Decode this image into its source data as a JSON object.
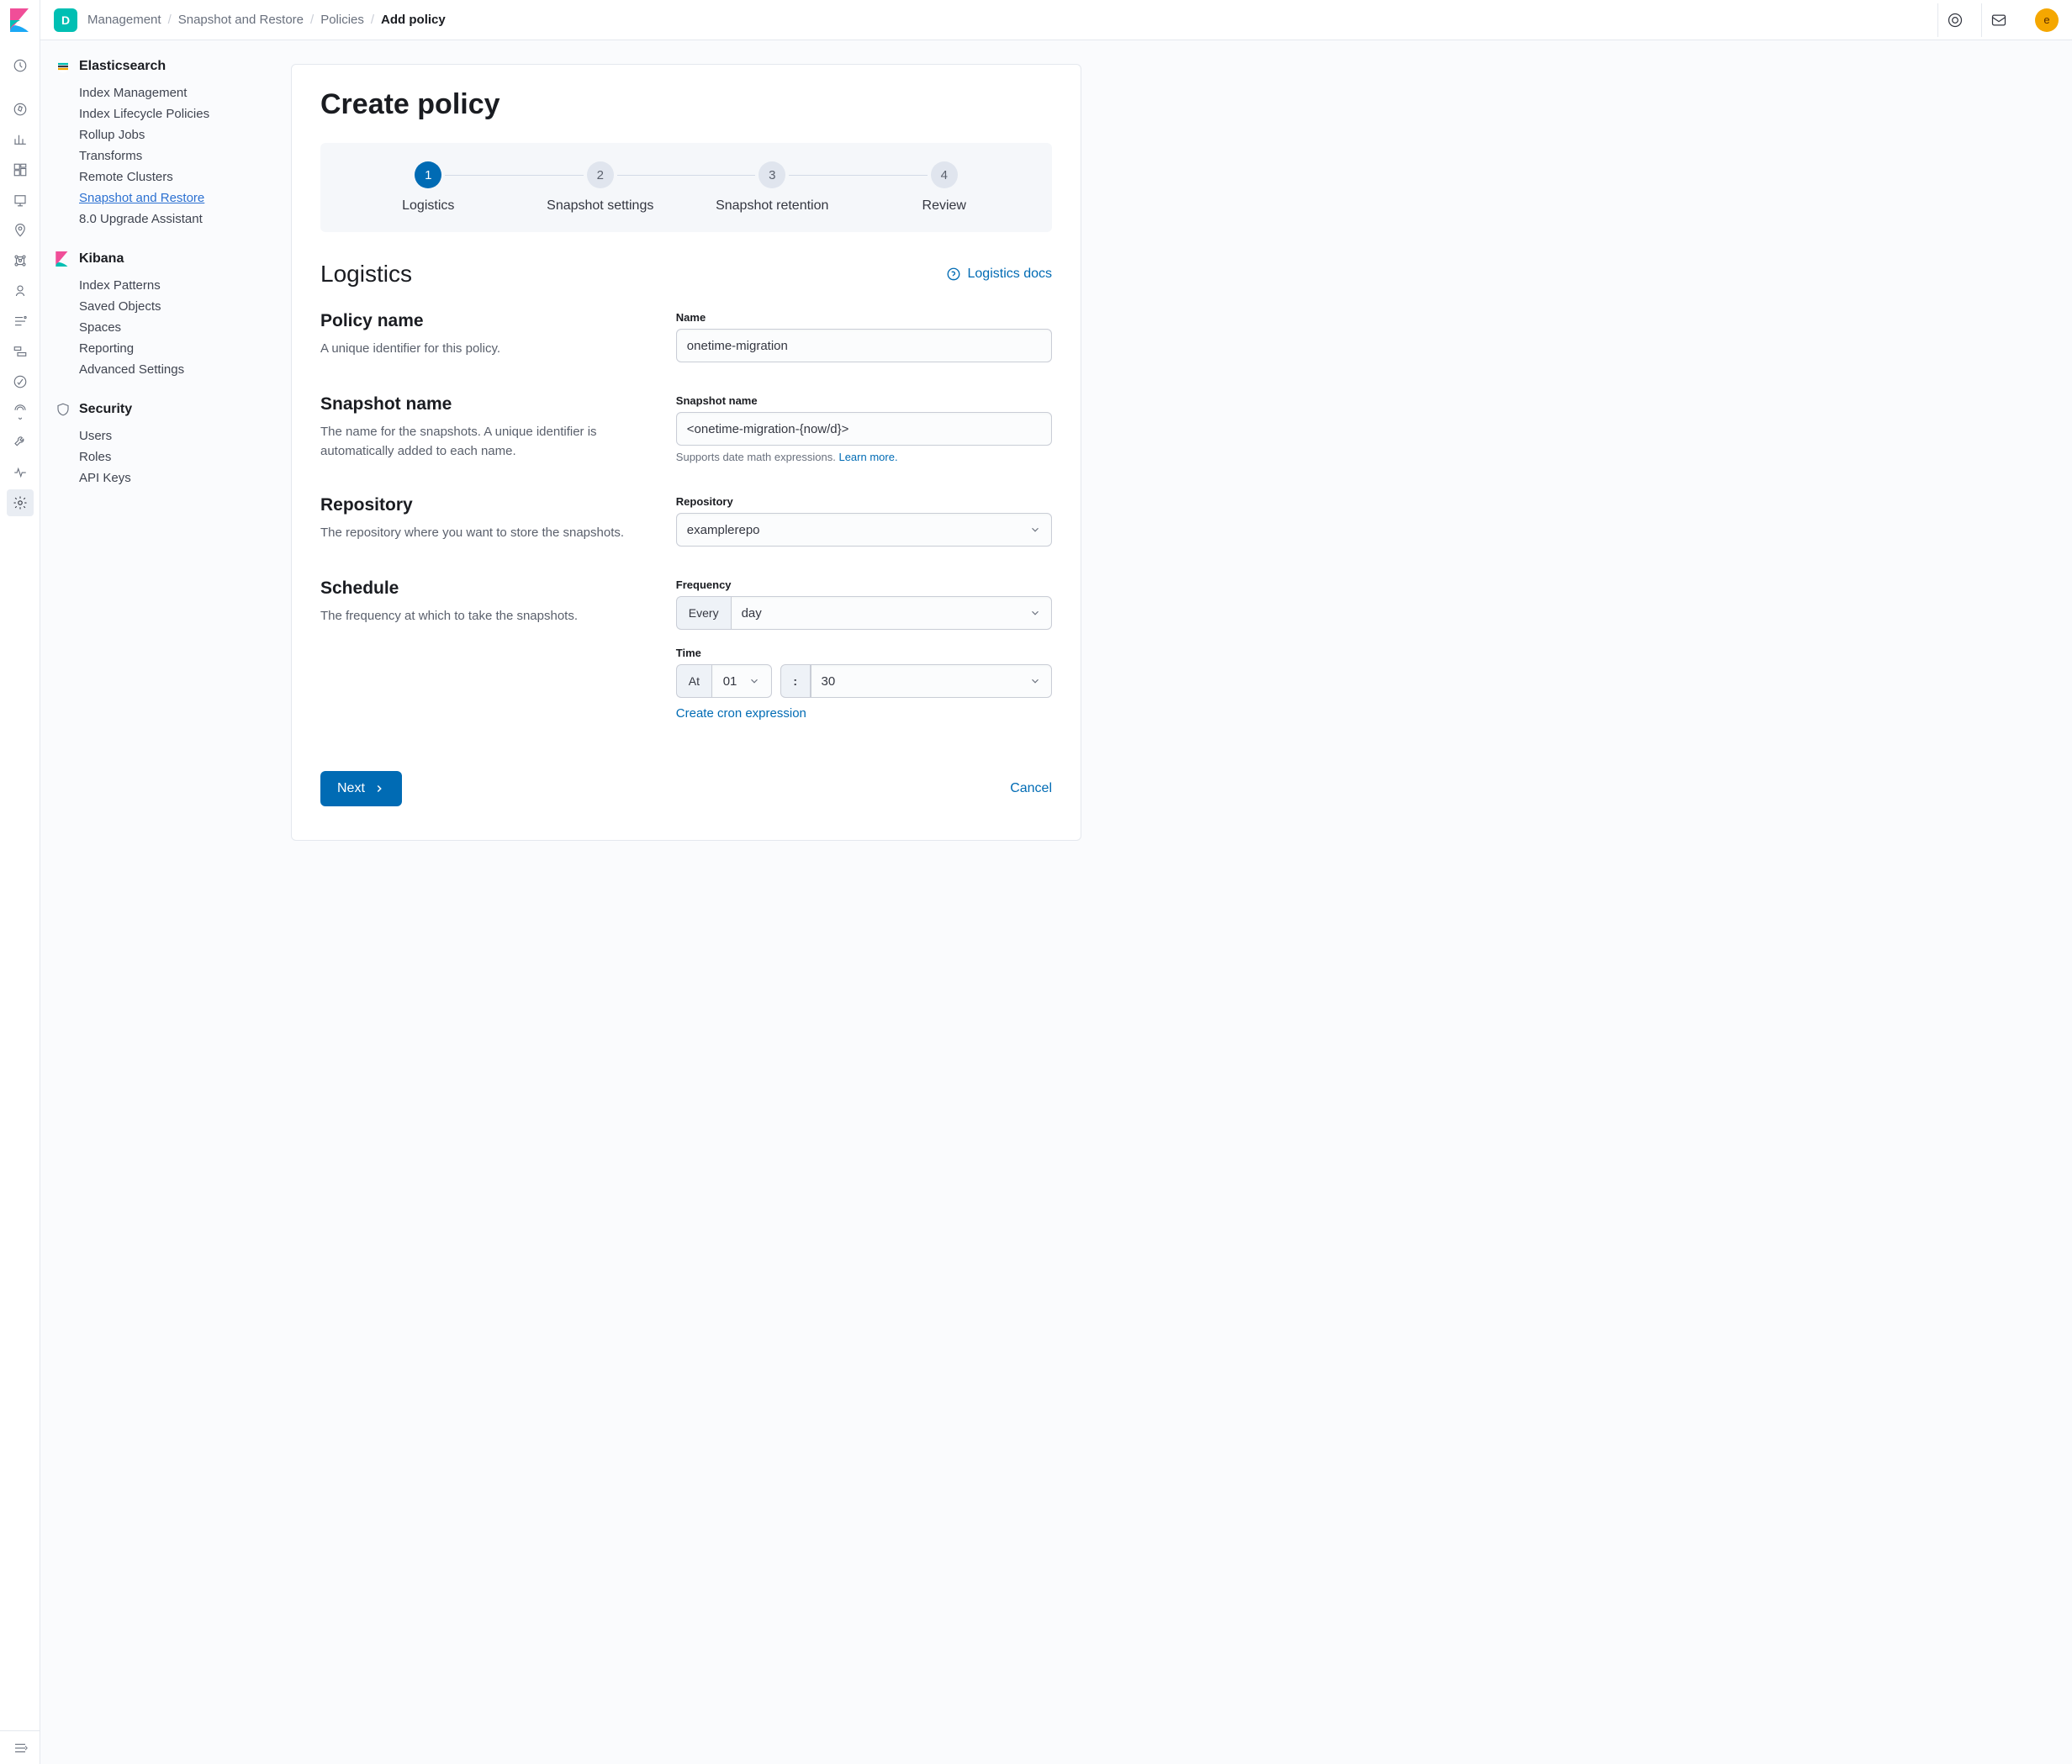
{
  "space_letter": "D",
  "avatar_letter": "e",
  "breadcrumb": [
    "Management",
    "Snapshot and Restore",
    "Policies",
    "Add policy"
  ],
  "sidebar": {
    "sections": [
      {
        "title": "Elasticsearch",
        "icon": "es",
        "items": [
          {
            "label": "Index Management"
          },
          {
            "label": "Index Lifecycle Policies"
          },
          {
            "label": "Rollup Jobs"
          },
          {
            "label": "Transforms"
          },
          {
            "label": "Remote Clusters"
          },
          {
            "label": "Snapshot and Restore",
            "current": true
          },
          {
            "label": "8.0 Upgrade Assistant"
          }
        ]
      },
      {
        "title": "Kibana",
        "icon": "kb",
        "items": [
          {
            "label": "Index Patterns"
          },
          {
            "label": "Saved Objects"
          },
          {
            "label": "Spaces"
          },
          {
            "label": "Reporting"
          },
          {
            "label": "Advanced Settings"
          }
        ]
      },
      {
        "title": "Security",
        "icon": "sec",
        "items": [
          {
            "label": "Users"
          },
          {
            "label": "Roles"
          },
          {
            "label": "API Keys"
          }
        ]
      }
    ]
  },
  "page": {
    "title": "Create policy",
    "steps": [
      {
        "num": "1",
        "label": "Logistics",
        "active": true
      },
      {
        "num": "2",
        "label": "Snapshot settings"
      },
      {
        "num": "3",
        "label": "Snapshot retention"
      },
      {
        "num": "4",
        "label": "Review"
      }
    ],
    "section_heading": "Logistics",
    "docs_link": "Logistics docs",
    "rows": {
      "policy_name": {
        "title": "Policy name",
        "desc": "A unique identifier for this policy.",
        "field_label": "Name",
        "value": "onetime-migration"
      },
      "snapshot_name": {
        "title": "Snapshot name",
        "desc": "The name for the snapshots. A unique identifier is automatically added to each name.",
        "field_label": "Snapshot name",
        "value": "<onetime-migration-{now/d}>",
        "help_prefix": "Supports date math expressions. ",
        "help_link": "Learn more."
      },
      "repository": {
        "title": "Repository",
        "desc": "The repository where you want to store the snapshots.",
        "field_label": "Repository",
        "value": "examplerepo"
      },
      "schedule": {
        "title": "Schedule",
        "desc": "The frequency at which to take the snapshots.",
        "freq_label": "Frequency",
        "freq_prepend": "Every",
        "freq_value": "day",
        "time_label": "Time",
        "time_prepend": "At",
        "hour_value": "01",
        "colon": ":",
        "minute_value": "30",
        "cron_link": "Create cron expression"
      }
    },
    "next_button": "Next",
    "cancel_button": "Cancel"
  }
}
